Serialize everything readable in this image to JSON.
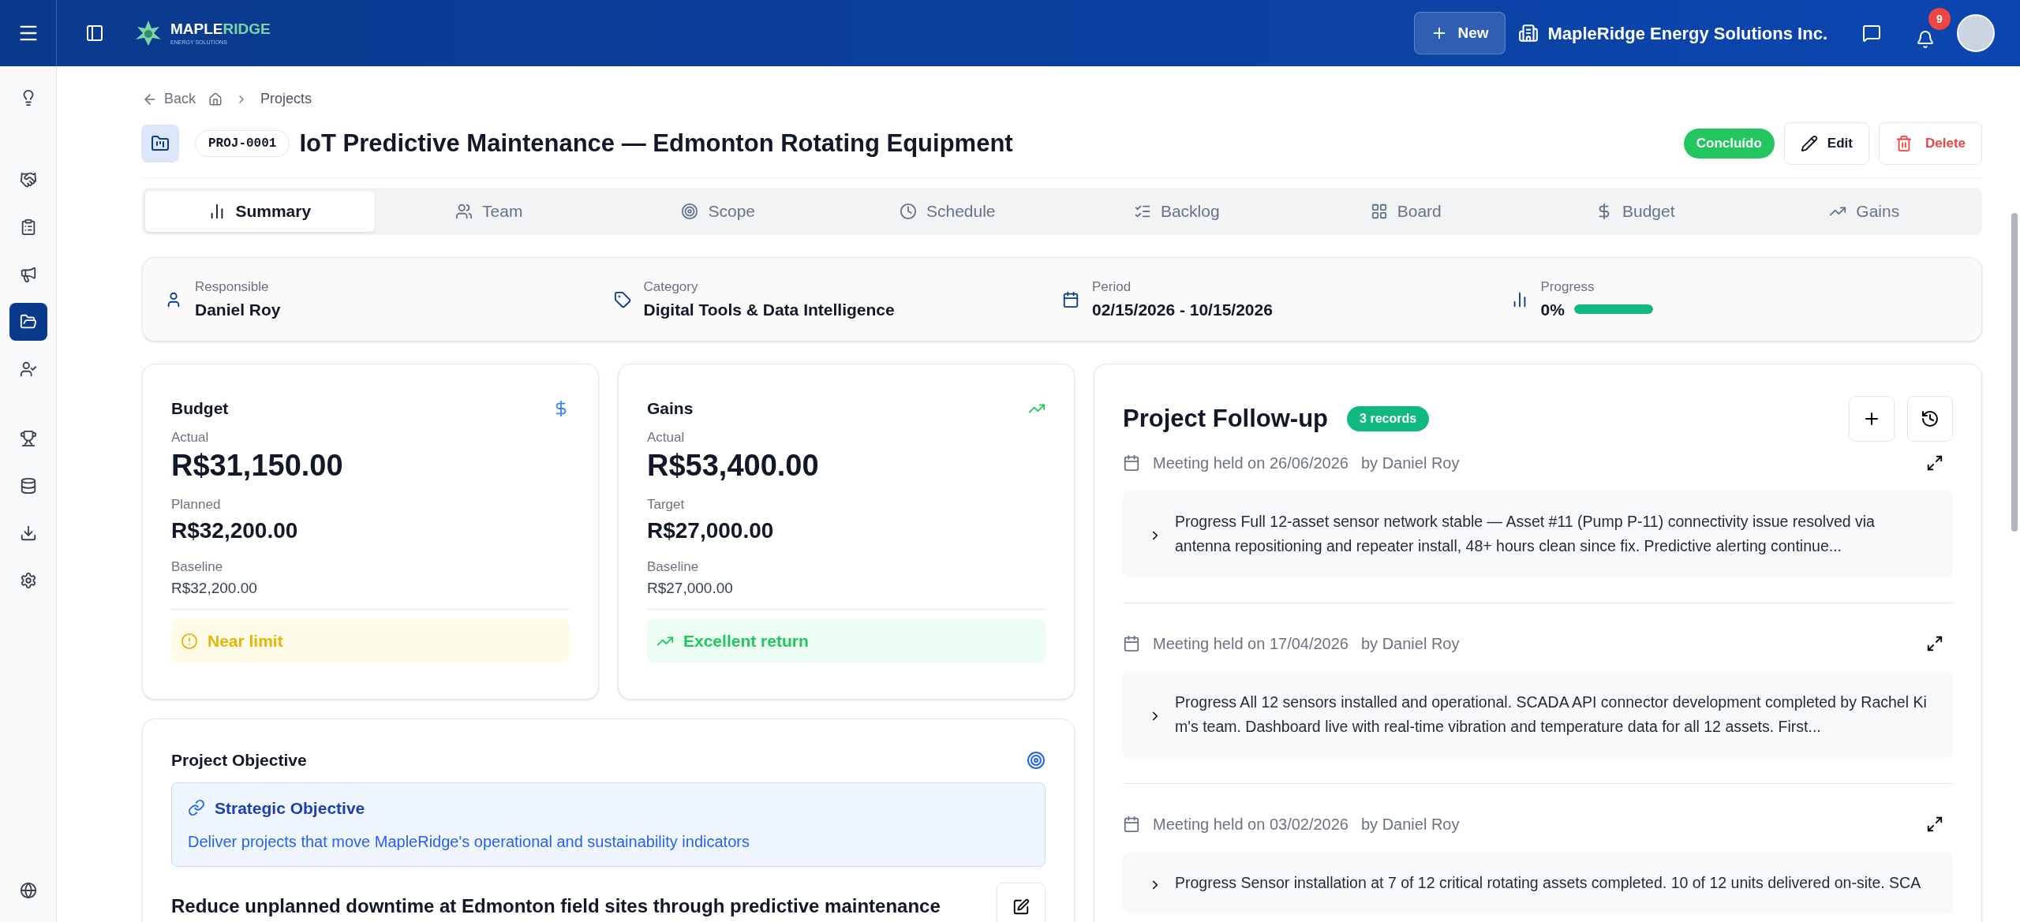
{
  "header": {
    "logo": {
      "name_primary": "MAPLE",
      "name_accent": "RIDGE",
      "tagline": "ENERGY SOLUTIONS"
    },
    "new_button": "New",
    "company": "MapleRidge Energy Solutions Inc.",
    "notification_count": "9"
  },
  "sidebar": {
    "items": [
      {
        "selected": false
      },
      {
        "selected": false
      },
      {
        "selected": false
      },
      {
        "selected": false
      },
      {
        "selected": true
      },
      {
        "selected": false
      },
      {
        "selected": false
      },
      {
        "selected": false
      },
      {
        "selected": false
      },
      {
        "selected": false
      },
      {
        "selected": false
      }
    ]
  },
  "breadcrumb": {
    "back": "Back",
    "current": "Projects"
  },
  "project": {
    "code": "PROJ-0001",
    "title": "IoT Predictive Maintenance — Edmonton Rotating Equipment",
    "status": "Concluído",
    "edit": "Edit",
    "delete": "Delete"
  },
  "tabs": [
    {
      "label": "Summary",
      "selected": true
    },
    {
      "label": "Team",
      "selected": false
    },
    {
      "label": "Scope",
      "selected": false
    },
    {
      "label": "Schedule",
      "selected": false
    },
    {
      "label": "Backlog",
      "selected": false
    },
    {
      "label": "Board",
      "selected": false
    },
    {
      "label": "Budget",
      "selected": false
    },
    {
      "label": "Gains",
      "selected": false
    }
  ],
  "info": {
    "responsible": {
      "label": "Responsible",
      "value": "Daniel Roy"
    },
    "category": {
      "label": "Category",
      "value": "Digital Tools & Data Intelligence"
    },
    "period": {
      "label": "Period",
      "value": "02/15/2026 - 10/15/2026"
    },
    "progress": {
      "label": "Progress",
      "value": "0%",
      "level": 1
    }
  },
  "budget": {
    "title": "Budget",
    "actual_label": "Actual",
    "actual": "R$31,150.00",
    "second_label": "Planned",
    "second": "R$32,200.00",
    "baseline_label": "Baseline",
    "baseline": "R$32,200.00",
    "status": {
      "kind": "warning",
      "label": "Near limit"
    }
  },
  "gains": {
    "title": "Gains",
    "actual_label": "Actual",
    "actual": "R$53,400.00",
    "second_label": "Target",
    "second": "R$27,000.00",
    "baseline_label": "Baseline",
    "baseline": "R$27,000.00",
    "status": {
      "kind": "success",
      "label": "Excellent return"
    }
  },
  "objective": {
    "title": "Project Objective",
    "strategic_title": "Strategic Objective",
    "strategic_text": "Deliver projects that move MapleRidge's operational and sustainability indicators",
    "statement": "Reduce unplanned downtime at Edmonton field sites through predictive maintenance"
  },
  "follow_up": {
    "title": "Project Follow-up",
    "count": "3 records",
    "records": [
      {
        "meeting": "Meeting held on 26/06/2026",
        "author": "by Daniel Roy",
        "expanded": false,
        "text": "Progress Full 12-asset sensor network stable — Asset #11 (Pump P-11) connectivity issue resolved via antenna repositioning and repeater install, 48+ hours clean since fix. Predictive alerting continue..."
      },
      {
        "meeting": "Meeting held on 17/04/2026",
        "author": "by Daniel Roy",
        "expanded": false,
        "text": "Progress All 12 sensors installed and operational. SCADA API connector development completed by Rachel Ki m's team. Dashboard live with real-time vibration and temperature data for all 12 assets. First..."
      },
      {
        "meeting": "Meeting held on 03/02/2026",
        "author": "by Daniel Roy",
        "expanded": false,
        "text": "Progress Sensor installation at 7 of 12 critical rotating assets completed. 10 of 12 units delivered on-site. SCA"
      }
    ]
  }
}
